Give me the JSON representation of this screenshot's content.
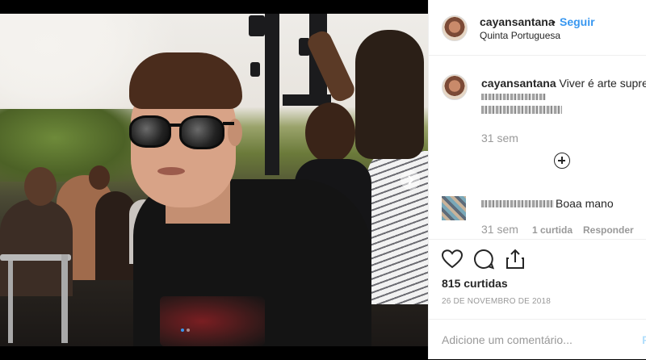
{
  "post": {
    "username": "cayansantana",
    "separator": "•",
    "follow_label": "Seguir",
    "location": "Quinta Portuguesa"
  },
  "caption": {
    "username": "cayansantana",
    "text": "Viver é arte suprema",
    "age": "31 sem"
  },
  "comment": {
    "text": "Boaa mano",
    "age": "31 sem",
    "likes": "1 curtida",
    "reply_label": "Responder"
  },
  "stats": {
    "likes": "815 curtidas",
    "date": "26 DE NOVEMBRO DE 2018"
  },
  "composer": {
    "placeholder": "Adicione um comentário...",
    "post_label": "P"
  },
  "icons": {
    "like": "heart-icon",
    "comment": "comment-bubble-icon",
    "share": "share-icon",
    "load_more": "plus-circle-icon",
    "next": "chevron-right-icon"
  },
  "colors": {
    "link": "#3897f0",
    "muted": "#999999",
    "text": "#262626"
  }
}
